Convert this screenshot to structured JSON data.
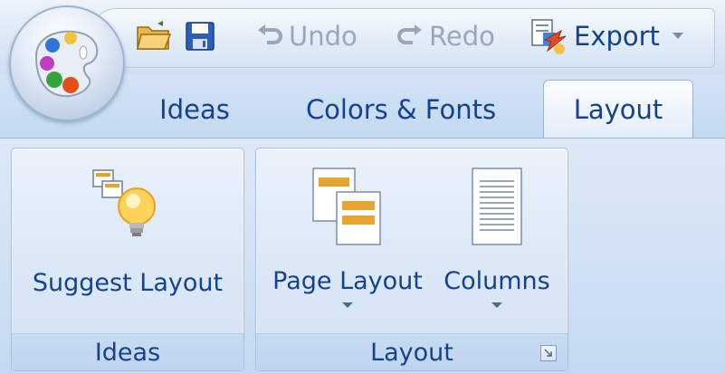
{
  "quick_access": {
    "undo_label": "Undo",
    "redo_label": "Redo",
    "export_label": "Export"
  },
  "tabs": [
    {
      "label": "Ideas",
      "active": false
    },
    {
      "label": "Colors & Fonts",
      "active": false
    },
    {
      "label": "Layout",
      "active": true
    }
  ],
  "ribbon": {
    "groups": [
      {
        "label": "Ideas",
        "buttons": [
          {
            "label": "Suggest Layout",
            "icon": "lightbulb-icon"
          }
        ]
      },
      {
        "label": "Layout",
        "buttons": [
          {
            "label": "Page Layout",
            "icon": "page-layout-icon",
            "has_dropdown": true
          },
          {
            "label": "Columns",
            "icon": "columns-icon",
            "has_dropdown": true
          }
        ]
      }
    ]
  },
  "colors": {
    "text_primary": "#15428b",
    "text_disabled": "#9aa7b6",
    "ribbon_background": "#cfe0f4"
  }
}
